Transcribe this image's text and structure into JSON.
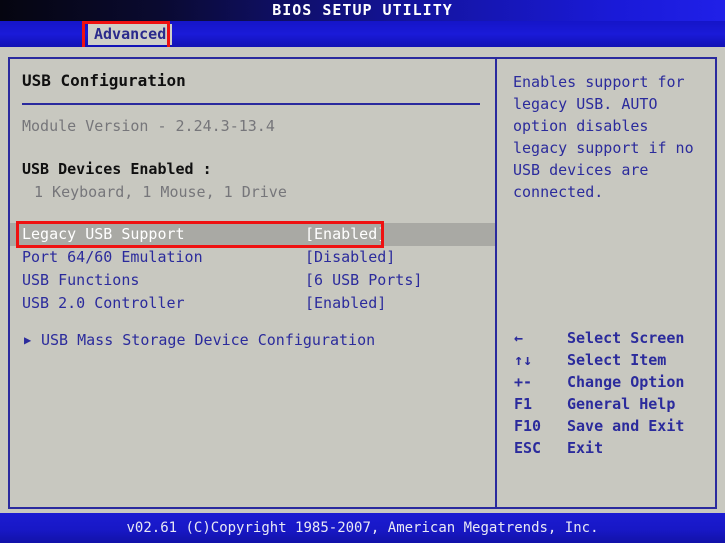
{
  "window": {
    "title": "BIOS SETUP UTILITY"
  },
  "menubar": {
    "tabs": [
      {
        "label": "Advanced",
        "active": true
      }
    ]
  },
  "main": {
    "section_title": "USB Configuration",
    "module_version": "Module Version - 2.24.3-13.4",
    "devices_label": "USB Devices Enabled :",
    "devices_value": "1 Keyboard, 1 Mouse, 1 Drive",
    "settings": [
      {
        "label": "Legacy USB Support",
        "value": "[Enabled]",
        "selected": true
      },
      {
        "label": "Port 64/60 Emulation",
        "value": "[Disabled]",
        "selected": false
      },
      {
        "label": "USB Functions",
        "value": "[6 USB Ports]",
        "selected": false
      },
      {
        "label": "USB 2.0 Controller",
        "value": "[Enabled]",
        "selected": false
      }
    ],
    "submenu": {
      "arrow": "▶",
      "label": "USB Mass Storage Device Configuration"
    }
  },
  "help": {
    "text": "Enables support for legacy USB. AUTO option disables legacy support if no USB devices are connected.",
    "legend": [
      {
        "key": "←",
        "desc": "Select Screen"
      },
      {
        "key": "↑↓",
        "desc": "Select Item"
      },
      {
        "key": "+-",
        "desc": "Change Option"
      },
      {
        "key": "F1",
        "desc": "General Help"
      },
      {
        "key": "F10",
        "desc": "Save and Exit"
      },
      {
        "key": "ESC",
        "desc": "Exit"
      }
    ]
  },
  "footer": {
    "text": "v02.61 (C)Copyright 1985-2007, American Megatrends, Inc."
  },
  "colors": {
    "screen_bg": "#c8c8c0",
    "panel_border": "#2a2a9e",
    "accent_blue": "#1a1ad8",
    "text_blue": "#2b2b9c",
    "text_black": "#101010",
    "text_gray": "#76767a",
    "selected_bg": "#a9a9a4",
    "selected_fg": "#ffffff",
    "annotation_red": "#ef1111"
  }
}
